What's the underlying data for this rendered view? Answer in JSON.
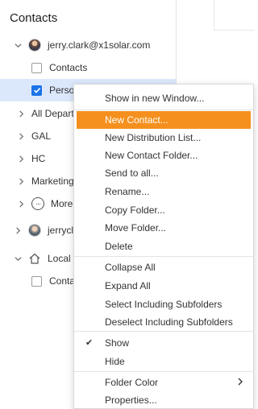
{
  "sidebar": {
    "title": "Contacts",
    "rows": [
      {
        "label": "jerry.clark@x1solar.com",
        "kind": "account"
      },
      {
        "label": "Contacts",
        "kind": "folder",
        "checked": false
      },
      {
        "label": "Personal",
        "kind": "folder",
        "checked": true,
        "selected": true
      },
      {
        "label": "All Departments",
        "kind": "group"
      },
      {
        "label": "GAL",
        "kind": "group"
      },
      {
        "label": "HC",
        "kind": "group"
      },
      {
        "label": "Marketing",
        "kind": "group"
      },
      {
        "label": "More",
        "kind": "more"
      },
      {
        "label": "jerryclark",
        "kind": "account"
      },
      {
        "label": "Local Folders",
        "kind": "local"
      },
      {
        "label": "Contacts",
        "kind": "folder",
        "checked": false
      }
    ]
  },
  "context_menu": {
    "items": [
      {
        "label": "Show in new Window..."
      },
      {
        "label": "New Contact...",
        "highlighted": true
      },
      {
        "label": "New Distribution List..."
      },
      {
        "label": "New Contact Folder..."
      },
      {
        "label": "Send to all..."
      },
      {
        "label": "Rename..."
      },
      {
        "label": "Copy Folder..."
      },
      {
        "label": "Move Folder..."
      },
      {
        "label": "Delete"
      },
      {
        "label": "Collapse All"
      },
      {
        "label": "Expand All"
      },
      {
        "label": "Select Including Subfolders"
      },
      {
        "label": "Deselect Including Subfolders"
      },
      {
        "label": "Show",
        "checked": true
      },
      {
        "label": "Hide"
      },
      {
        "label": "Folder Color",
        "submenu": true
      },
      {
        "label": "Properties..."
      }
    ]
  },
  "colors": {
    "highlight": "#f5901e",
    "selection": "#dbe8fb",
    "checkbox_checked": "#1a73e8"
  }
}
